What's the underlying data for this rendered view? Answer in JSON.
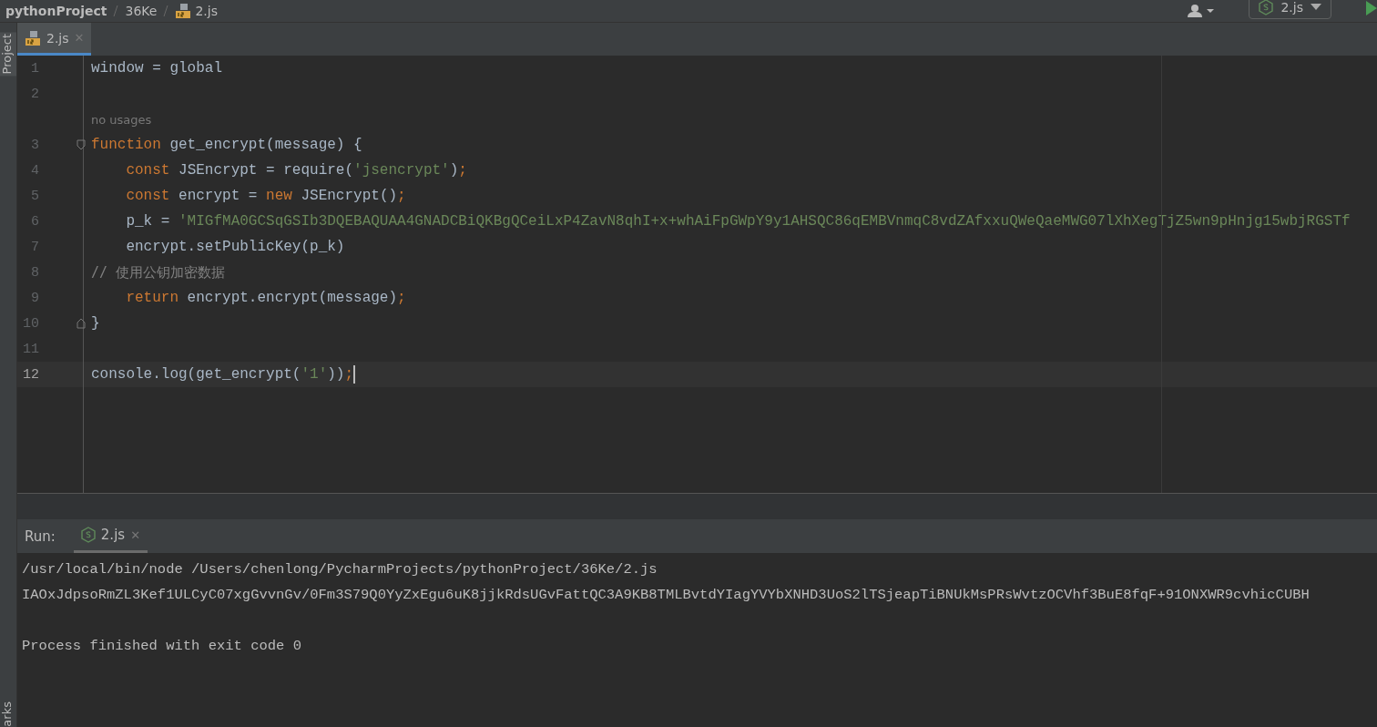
{
  "breadcrumbs": [
    {
      "label": "pythonProject",
      "kind": "project"
    },
    {
      "label": "36Ke",
      "kind": "folder"
    },
    {
      "label": "2.js",
      "kind": "file"
    }
  ],
  "run_config": {
    "label": "2.js"
  },
  "tool_windows": {
    "top": "Project",
    "bottom": "arks"
  },
  "editor_tabs": [
    {
      "label": "2.js",
      "close": "✕",
      "selected": true
    }
  ],
  "code_lines": [
    {
      "kind": "code",
      "number": "1",
      "tokens": [
        {
          "t": "window = global",
          "kind": "plain"
        }
      ]
    },
    {
      "kind": "code",
      "number": "2"
    },
    {
      "kind": "hint",
      "text": "no usages"
    },
    {
      "kind": "fold_start",
      "number": "3",
      "tokens": [
        {
          "t": "function",
          "kind": "keyword"
        },
        {
          "t": " get_encrypt(message) {",
          "kind": "plain"
        }
      ]
    },
    {
      "kind": "code",
      "number": "4",
      "indented": true,
      "tokens": [
        {
          "t": "const",
          "kind": "keyword"
        },
        {
          "t": " JSEncrypt = require(",
          "kind": "plain"
        },
        {
          "t": "'jsencrypt'",
          "kind": "string"
        },
        {
          "t": ")",
          "kind": "plain"
        },
        {
          "t": ";",
          "kind": "keyword"
        }
      ]
    },
    {
      "kind": "code",
      "number": "5",
      "indented": true,
      "tokens": [
        {
          "t": "const",
          "kind": "keyword"
        },
        {
          "t": " encrypt = ",
          "kind": "plain"
        },
        {
          "t": "new",
          "kind": "keyword"
        },
        {
          "t": " JSEncrypt()",
          "kind": "plain"
        },
        {
          "t": ";",
          "kind": "keyword"
        }
      ]
    },
    {
      "kind": "code",
      "number": "6",
      "indented": true,
      "tokens": [
        {
          "t": "p_k = ",
          "kind": "plain"
        },
        {
          "t": "'MIGfMA0GCSqGSIb3DQEBAQUAA4GNADCBiQKBgQCeiLxP4ZavN8qhI+x+whAiFpGWpY9y1AHSQC86qEMBVnmqC8vdZAfxxuQWeQaeMWG07lXhXegTjZ5wn9pHnjg15wbjRGSTf",
          "kind": "string"
        }
      ]
    },
    {
      "kind": "code",
      "number": "7",
      "indented": true,
      "tokens": [
        {
          "t": "encrypt.setPublicKey(p_k)",
          "kind": "plain"
        }
      ]
    },
    {
      "kind": "code",
      "number": "8",
      "tokens": [
        {
          "t": "// 使用公钥加密数据",
          "kind": "comment"
        }
      ]
    },
    {
      "kind": "code",
      "number": "9",
      "indented": true,
      "tokens": [
        {
          "t": "return",
          "kind": "keyword"
        },
        {
          "t": " encrypt.encrypt(message)",
          "kind": "plain"
        },
        {
          "t": ";",
          "kind": "keyword"
        }
      ]
    },
    {
      "kind": "fold_end",
      "number": "10",
      "tokens": [
        {
          "t": "}",
          "kind": "plain"
        }
      ]
    },
    {
      "kind": "code",
      "number": "11"
    },
    {
      "kind": "code",
      "number": "12",
      "current": true,
      "tokens": [
        {
          "t": "console.log(get_encrypt(",
          "kind": "plain"
        },
        {
          "t": "'1'",
          "kind": "string"
        },
        {
          "t": "))",
          "kind": "plain"
        },
        {
          "t": ";",
          "kind": "keyword"
        }
      ]
    }
  ],
  "run_panel": {
    "label": "Run:",
    "tabs": [
      {
        "label": "2.js",
        "close": "✕",
        "selected": true
      }
    ],
    "output": [
      {
        "kind": "command",
        "text": "/usr/local/bin/node /Users/chenlong/PycharmProjects/pythonProject/36Ke/2.js"
      },
      {
        "kind": "output",
        "text": "IAOxJdpsoRmZL3Kef1ULCyC07xgGvvnGv/0Fm3S79Q0YyZxEgu6uK8jjkRdsUGvFattQC3A9KB8TMLBvtdYIagYVYbXNHD3UoS2lTSjeapTiBNUkMsPRsWvtzOCVhf3BuE8fqF+91ONXWR9cvhicCUBH"
      },
      {
        "kind": "status",
        "text": "Process finished with exit code 0"
      }
    ]
  }
}
